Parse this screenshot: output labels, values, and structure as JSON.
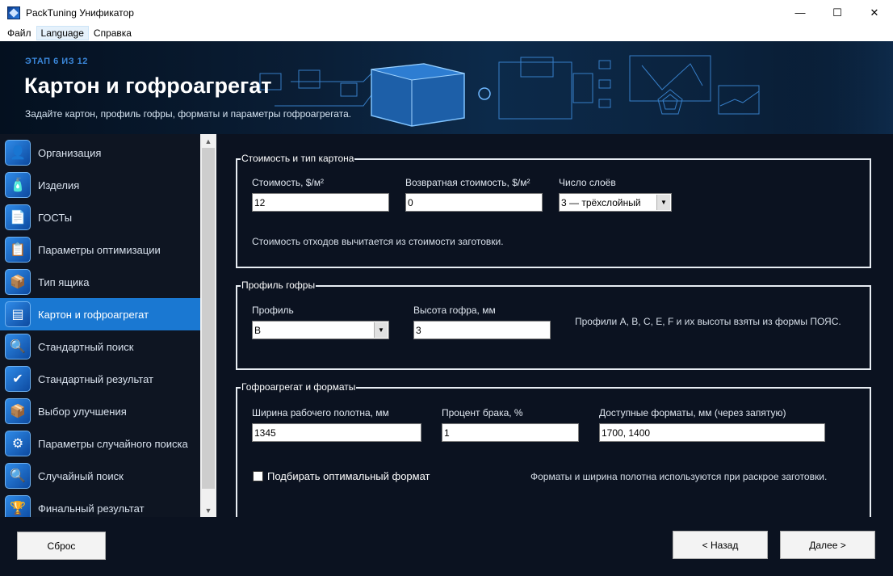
{
  "window": {
    "title": "PackTuning Унификатор",
    "controls": {
      "minimize": "—",
      "maximize": "☐",
      "close": "✕"
    }
  },
  "menu": [
    "Файл",
    "Language",
    "Справка"
  ],
  "banner": {
    "step": "ЭТАП 6 ИЗ 12",
    "title": "Картон и гофроагрегат",
    "subtitle": "Задайте картон, профиль гофры, форматы и параметры гофроагрегата."
  },
  "sidebar": {
    "items": [
      {
        "label": "Организация",
        "icon": "organization-icon",
        "glyph": "👤"
      },
      {
        "label": "Изделия",
        "icon": "products-icon",
        "glyph": "🧴"
      },
      {
        "label": "ГОСТы",
        "icon": "gost-icon",
        "glyph": "📄"
      },
      {
        "label": "Параметры оптимизации",
        "icon": "optimization-params-icon",
        "glyph": "📋"
      },
      {
        "label": "Тип ящика",
        "icon": "box-type-icon",
        "glyph": "📦"
      },
      {
        "label": "Картон и гофроагрегат",
        "icon": "cardboard-icon",
        "glyph": "▤",
        "active": true
      },
      {
        "label": "Стандартный поиск",
        "icon": "standard-search-icon",
        "glyph": "🔍"
      },
      {
        "label": "Стандартный результат",
        "icon": "standard-result-icon",
        "glyph": "✔"
      },
      {
        "label": "Выбор улучшения",
        "icon": "improvement-icon",
        "glyph": "📦"
      },
      {
        "label": "Параметры случайного поиска",
        "icon": "random-params-icon",
        "glyph": "⚙"
      },
      {
        "label": "Случайный поиск",
        "icon": "random-search-icon",
        "glyph": "🔍"
      },
      {
        "label": "Финальный результат",
        "icon": "final-result-icon",
        "glyph": "🏆"
      }
    ]
  },
  "cost_group": {
    "title": "Стоимость и тип картона",
    "cost_label": "Стоимость, $/м²",
    "cost_value": "12",
    "return_label": "Возвратная стоимость, $/м²",
    "return_value": "0",
    "layers_label": "Число слоёв",
    "layers_value": "3 — трёхслойный",
    "note": "Стоимость отходов вычитается из стоимости заготовки."
  },
  "profile_group": {
    "title": "Профиль гофры",
    "profile_label": "Профиль",
    "profile_value": "B",
    "height_label": "Высота гофра, мм",
    "height_value": "3",
    "note": "Профили A, B, C, E, F и их высоты взяты из формы ПОЯС."
  },
  "corrugator_group": {
    "title": "Гофроагрегат и форматы",
    "width_label": "Ширина рабочего полотна, мм",
    "width_value": "1345",
    "defect_label": "Процент брака, %",
    "defect_value": "1",
    "formats_label": "Доступные форматы, мм (через запятую)",
    "formats_value": "1700, 1400",
    "optimal_label": "Подбирать оптимальный формат",
    "optimal_checked": false,
    "note": "Форматы и ширина полотна используются при раскрое заготовки."
  },
  "buttons": {
    "reset": "Сброс",
    "back": "< Назад",
    "next": "Далее >"
  }
}
